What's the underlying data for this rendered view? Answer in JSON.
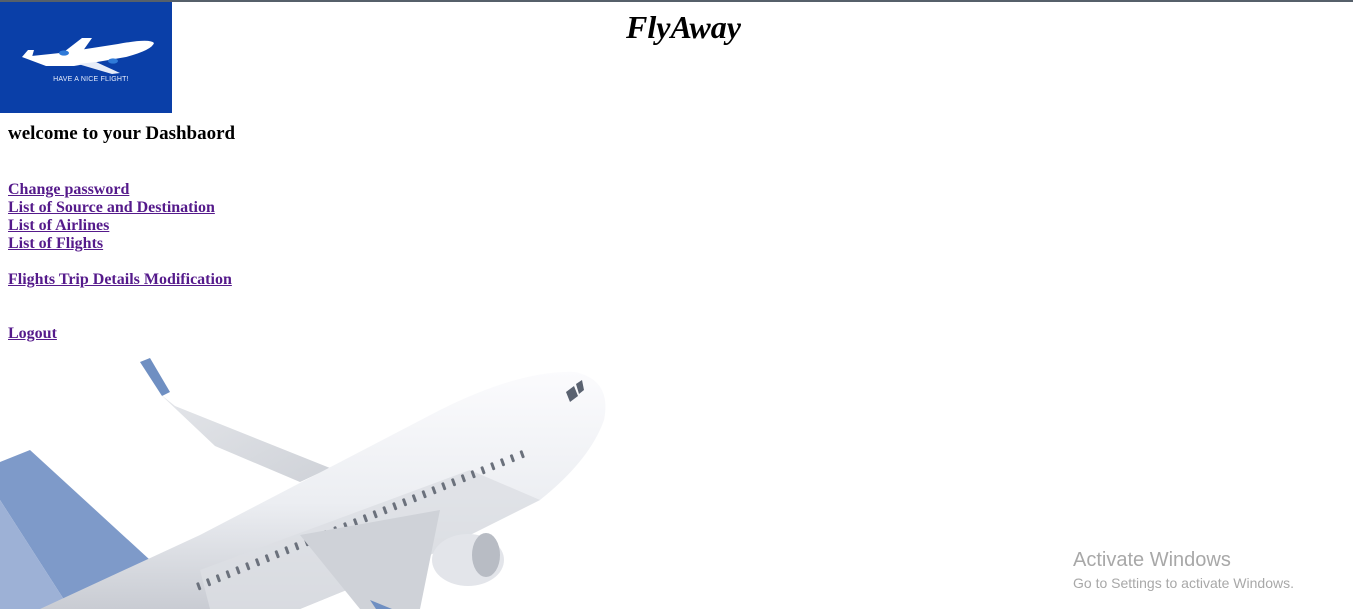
{
  "header": {
    "title": "FlyAway",
    "logo": {
      "tagline": "HAVE A NICE FLIGHT!",
      "background_color": "#0a3fa8",
      "icon": "airplane-icon"
    }
  },
  "main": {
    "welcome": "welcome to your Dashbaord",
    "links": [
      {
        "label": "Change password"
      },
      {
        "label": "List of Source and Destination"
      },
      {
        "label": "List of Airlines"
      },
      {
        "label": "List of Flights"
      },
      {
        "label": "Flights Trip Details Modification"
      },
      {
        "label": "Logout"
      }
    ],
    "link_color": "#551a8b",
    "background_image": "airplane-illustration"
  },
  "watermark": {
    "title": "Activate Windows",
    "subtitle": "Go to Settings to activate Windows."
  }
}
